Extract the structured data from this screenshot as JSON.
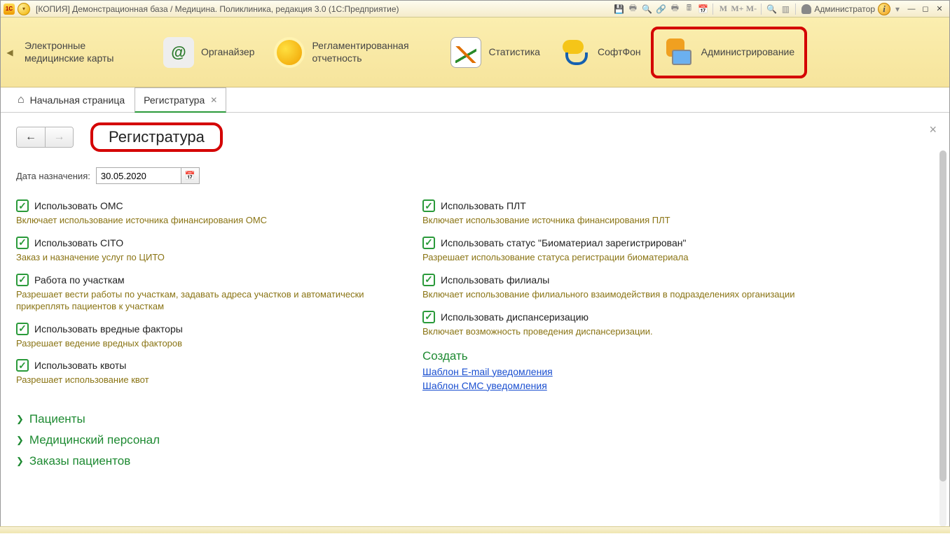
{
  "titlebar": {
    "app_badge": "1C",
    "title": "[КОПИЯ] Демонстрационная база / Медицина. Поликлиника, редакция 3.0  (1С:Предприятие)",
    "m_labels": [
      "M",
      "M+",
      "M-"
    ],
    "user_name": "Администратор",
    "info_glyph": "i"
  },
  "mainnav": {
    "items": [
      {
        "label": "Электронные медицинские карты"
      },
      {
        "label": "Органайзер"
      },
      {
        "label": "Регламентированная отчетность"
      },
      {
        "label": "Статистика"
      },
      {
        "label": "СофтФон"
      },
      {
        "label": "Администрирование"
      }
    ]
  },
  "tabs": {
    "home_label": "Начальная страница",
    "active_label": "Регистратура"
  },
  "page": {
    "title": "Регистратура",
    "date_label": "Дата назначения:",
    "date_value": "30.05.2020"
  },
  "options_left": [
    {
      "label": "Использовать ОМС",
      "desc": "Включает использование источника финансирования ОМС"
    },
    {
      "label": "Использовать CITO",
      "desc": "Заказ и назначение услуг по ЦИТО"
    },
    {
      "label": "Работа по участкам",
      "desc": "Разрешает вести работы по участкам, задавать адреса участков и автоматически прикреплять пациентов к участкам"
    },
    {
      "label": "Использовать вредные факторы",
      "desc": "Разрешает ведение вредных факторов"
    },
    {
      "label": "Использовать квоты",
      "desc": "Разрешает использование квот"
    }
  ],
  "options_right": [
    {
      "label": "Использовать ПЛТ",
      "desc": "Включает использование источника финансирования ПЛТ"
    },
    {
      "label": "Использовать статус \"Биоматериал зарегистрирован\"",
      "desc": "Разрешает использование статуса регистрации биоматериала"
    },
    {
      "label": "Использовать филиалы",
      "desc": "Включает использование филиального взаимодействия в подразделениях организации"
    },
    {
      "label": "Использовать диспансеризацию",
      "desc": "Включает возможность проведения диспансеризации."
    }
  ],
  "create": {
    "heading": "Создать",
    "link_email": "Шаблон E-mail уведомления",
    "link_sms": "Шаблон СМС уведомления"
  },
  "expanders": [
    "Пациенты",
    "Медицинский персонал",
    "Заказы пациентов"
  ]
}
